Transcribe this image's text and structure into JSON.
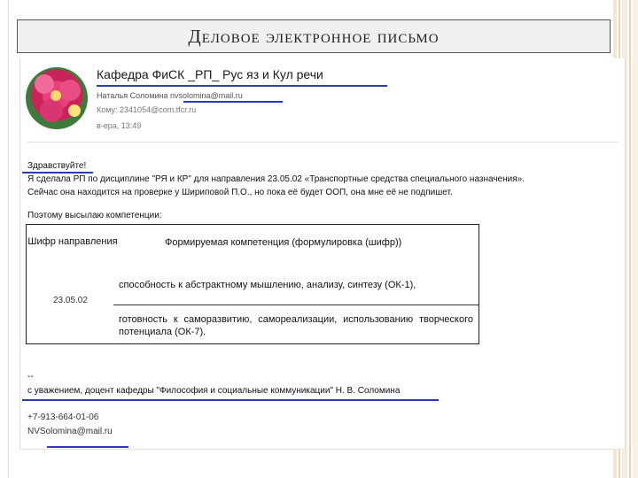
{
  "slide_title": "Деловое электронное письмо",
  "email": {
    "subject": "Кафедра ФиСК _РП_ Рус яз и Кул речи",
    "sender_name": "Наталья Соломина",
    "sender_email": "nvsolomina@mail.ru",
    "to": "Кому: 2341054@com.tfcr.ru",
    "date": "в-ера, 13:49",
    "greeting": "Здравствуйте!",
    "line1": "Я сделала РП по дисциплине \"РЯ и КР\" для направления 23.05.02 «Транспортные средства специального назначения».",
    "line2": "Сейчас она находится на проверке у Шириповой П.О., но пока её будет ООП, она мне её не подпишет.",
    "line3": "Поэтому высылаю компетенции:",
    "table": {
      "header_code": "Шифр направления",
      "header_comp": "Формируемая компетенция (формулировка    (шифр))",
      "code": "23.05.02",
      "comp1": "способность к абстрактному мышлению, анализу, синтезу (ОК-1),",
      "comp2": "готовность   к   саморазвитию,   самореализации,   использованию творческого потенциала (ОК-7)."
    },
    "signature_dash": "--",
    "signature": "с уважением, доцент кафедры \"Философия и социальные коммуникации\" Н. В. Соломина",
    "phone": "+7-913-664-01-06",
    "sig_email": "NVSolomina@mail.ru"
  },
  "colors": {
    "underline": "#2a3cb0",
    "title_bg": "#f0f0f0"
  }
}
